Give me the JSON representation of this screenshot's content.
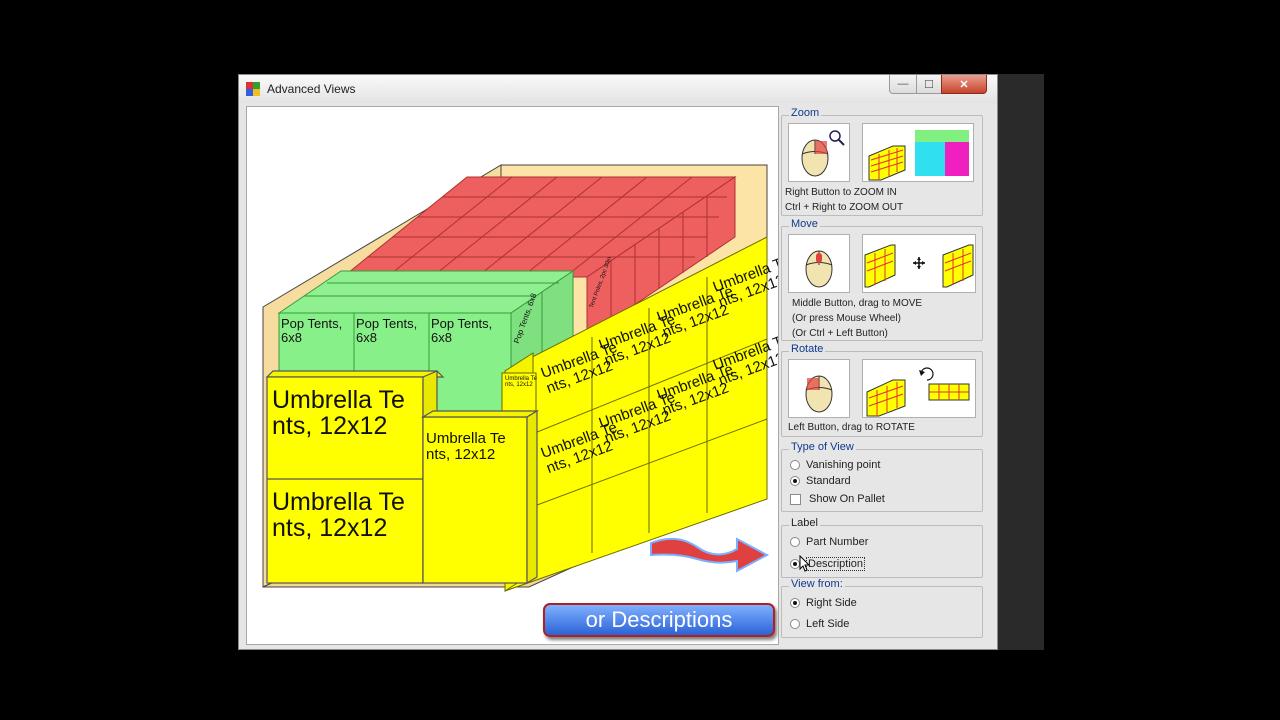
{
  "window": {
    "title": "Advanced Views",
    "min_glyph": "—",
    "max_glyph": "☐",
    "close_glyph": "✕"
  },
  "canvas": {
    "labels": {
      "pop_tents": "Pop Tents,\n6x8",
      "umbrella_large": "Umbrella Te\nnts, 12x12",
      "umbrella_small_top": "Umbrella Te\nnts, 12x12",
      "umbrella_tiny": "Umbrella Te\nnts, 12x12",
      "side_umbrella": "Umbrella Te\nnts, 12x12",
      "green_side": "Pop Tents, 6x8",
      "red_side": "Tent Poles, 2pc 30in"
    },
    "banner": "or Descriptions"
  },
  "panel": {
    "zoom": {
      "title": "Zoom",
      "line1": "Right Button to ZOOM IN",
      "line2": "Ctrl + Right to ZOOM OUT"
    },
    "move": {
      "title": "Move",
      "line1": "Middle Button, drag to MOVE",
      "line2": "(Or press Mouse Wheel)",
      "line3": "(Or Ctrl + Left Button)"
    },
    "rotate": {
      "title": "Rotate",
      "line1": "Left Button, drag to ROTATE"
    },
    "type_of_view": {
      "title": "Type of View",
      "options": [
        "Vanishing point",
        "Standard"
      ],
      "selected": "Standard",
      "checkbox": "Show On Pallet"
    },
    "label": {
      "title": "Label",
      "options": [
        "Part Number",
        "Description"
      ],
      "selected": "Description"
    },
    "view_from": {
      "title": "View from:",
      "options": [
        "Right Side",
        "Left Side"
      ],
      "selected": "Right Side"
    }
  },
  "colors": {
    "yellow": "#ffff00",
    "green": "#88f088",
    "red": "#ee6060",
    "accent_blue": "#0f3a8e"
  }
}
